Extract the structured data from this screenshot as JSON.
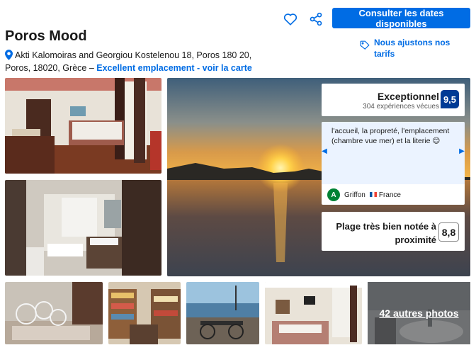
{
  "header": {
    "cta_label": "Consulter les dates disponibles",
    "save_icon": "heart-icon",
    "share_icon": "share-icon"
  },
  "property": {
    "name": "Poros Mood",
    "address": "Akti Kalomoiras and Georgiou Kostelenou 18, Poros 180 20, Poros, 18020, Grèce",
    "address_separator": " – ",
    "location_link": "Excellent emplacement - voir la carte"
  },
  "price_match": {
    "label": "Nous ajustons nos tarifs",
    "icon": "price-tag-icon"
  },
  "rating": {
    "label": "Exceptionnel",
    "count": "304 expériences vécues",
    "score": "9,5"
  },
  "review": {
    "text": "l'accueil, la propreté, l'emplacement (chambre vue mer) et la literie 😊",
    "reviewer_initial": "A",
    "reviewer_name": "Griffon",
    "reviewer_country": "France"
  },
  "beach": {
    "label": "Plage très bien notée à proximité",
    "score": "8,8"
  },
  "gallery": {
    "more_photos_label": "42 autres photos"
  },
  "colors": {
    "primary": "#006ce4",
    "score_badge": "#003b95",
    "review_bg": "#ebf3ff",
    "avatar": "#008234"
  }
}
